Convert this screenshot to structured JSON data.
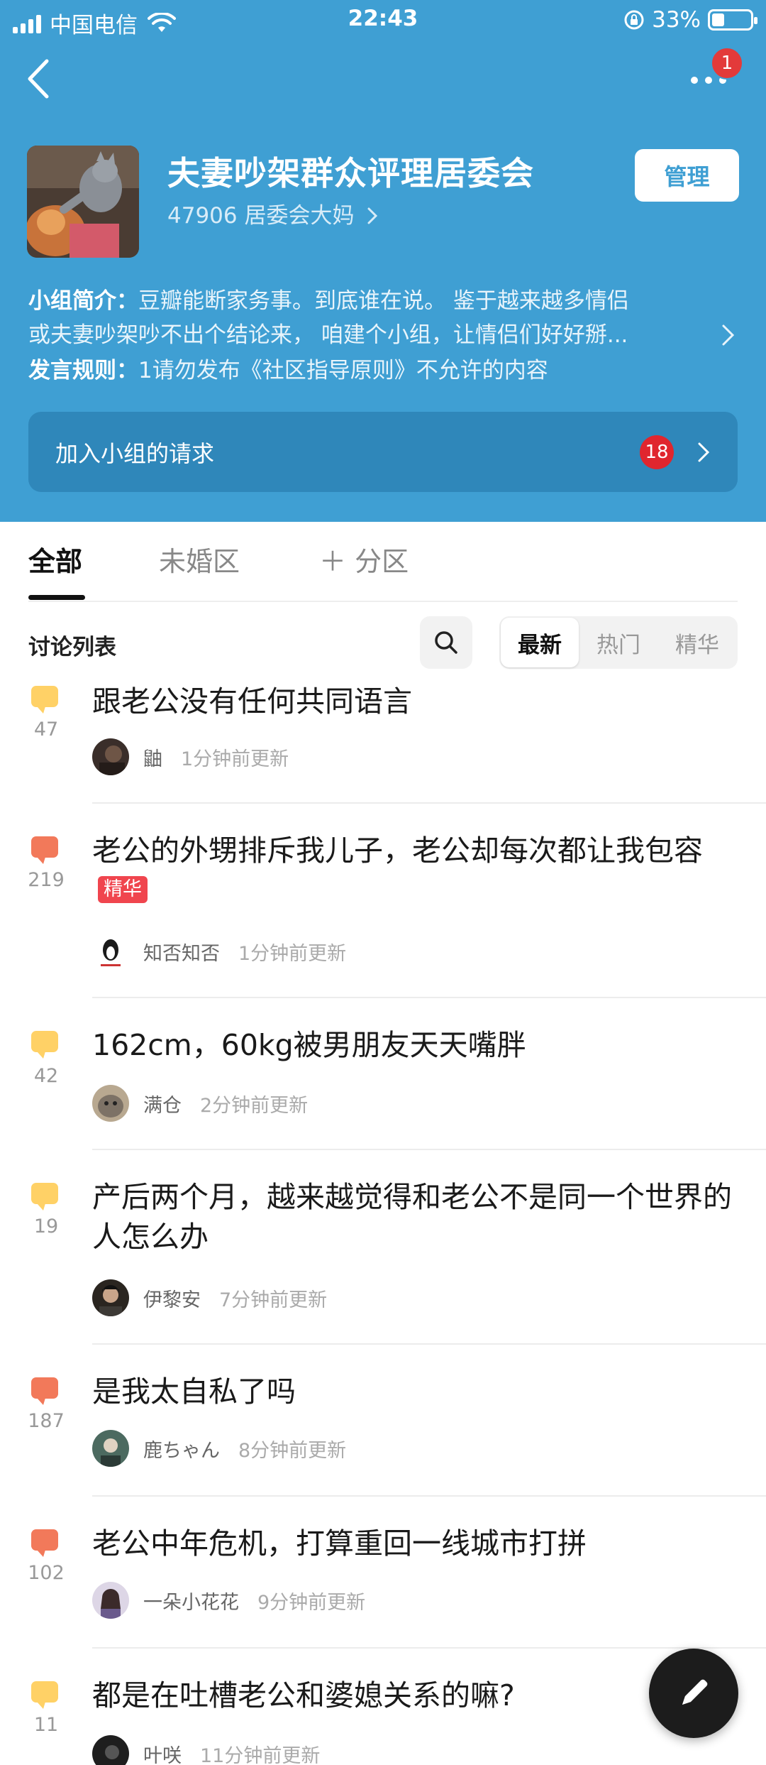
{
  "status_bar": {
    "carrier": "中国电信",
    "time": "22:43",
    "battery": "33%",
    "battery_level": 0.33
  },
  "header": {
    "more_badge": "1",
    "group_name": "夫妻吵架群众评理居委会",
    "members": "47906 居委会大妈",
    "manage_label": "管理",
    "intro_label": "小组简介：",
    "intro_line1": "豆瓣能断家务事。到底谁在说。 鉴于越来越多情侣",
    "intro_line2": "或夫妻吵架吵不出个结论来， 咱建个小组，让情侣们好好掰...",
    "rules_label": "发言规则：",
    "rules_text": "1请勿发布《社区指导原则》不允许的内容",
    "join_requests_label": "加入小组的请求",
    "join_requests_count": "18"
  },
  "tabs": [
    {
      "label": "全部",
      "active": true
    },
    {
      "label": "未婚区",
      "active": false
    },
    {
      "label": "＋ 分区",
      "active": false
    }
  ],
  "list": {
    "title": "讨论列表",
    "sort_options": [
      "最新",
      "热门",
      "精华"
    ],
    "active_sort": "最新"
  },
  "topics": [
    {
      "count": "47",
      "bubble": "yellow",
      "title": "跟老公没有任何共同语言",
      "featured": false,
      "author": "鼬",
      "time": "1分钟前更新"
    },
    {
      "count": "219",
      "bubble": "orange",
      "title": "老公的外甥排斥我儿子，老公却每次都让我包容",
      "featured": true,
      "featured_label": "精华",
      "author": "知否知否",
      "time": "1分钟前更新"
    },
    {
      "count": "42",
      "bubble": "yellow",
      "title": "162cm，60kg被男朋友天天嘴胖",
      "featured": false,
      "author": "满仓",
      "time": "2分钟前更新"
    },
    {
      "count": "19",
      "bubble": "yellow",
      "title": "产后两个月，越来越觉得和老公不是同一个世界的人怎么办",
      "featured": false,
      "author": "伊黎安",
      "time": "7分钟前更新"
    },
    {
      "count": "187",
      "bubble": "orange",
      "title": "是我太自私了吗",
      "featured": false,
      "author": "鹿ちゃん",
      "time": "8分钟前更新"
    },
    {
      "count": "102",
      "bubble": "orange",
      "title": "老公中年危机，打算重回一线城市打拼",
      "featured": false,
      "author": "一朵小花花",
      "time": "9分钟前更新"
    },
    {
      "count": "11",
      "bubble": "yellow",
      "title": "都是在吐槽老公和婆媳关系的嘛?",
      "featured": false,
      "author": "叶咲",
      "time": "11分钟前更新"
    }
  ],
  "colors": {
    "header_bg": "#3f9fd3",
    "join_bg": "#2f87ba",
    "badge_red": "#e0262e",
    "bubble_yellow": "#ffd166",
    "bubble_orange": "#f2795a",
    "featured_tag": "#f0454e"
  },
  "icons": {
    "back": "chevron-left-icon",
    "more": "more-dots-icon",
    "search": "search-icon",
    "compose": "pen-icon",
    "comment": "comment-bubble-icon"
  }
}
